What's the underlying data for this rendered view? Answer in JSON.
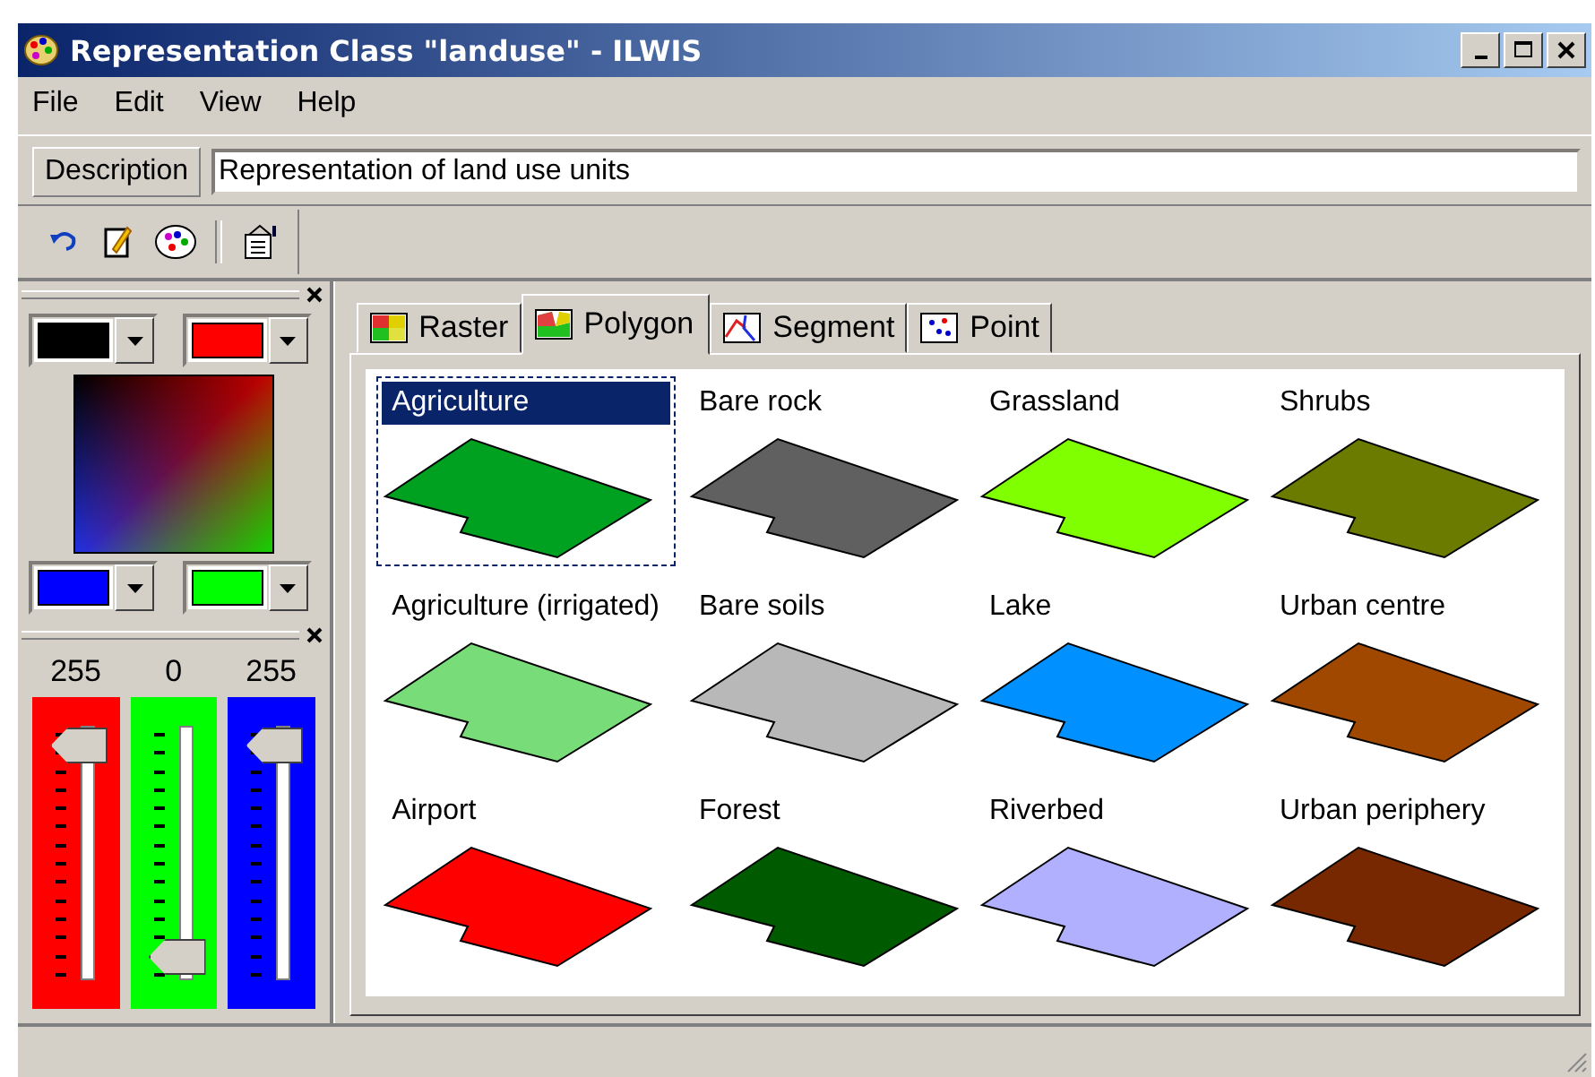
{
  "window": {
    "title": "Representation Class \"landuse\" - ILWIS"
  },
  "menu": [
    "File",
    "Edit",
    "View",
    "Help"
  ],
  "description": {
    "label": "Description",
    "value": "Representation of land use units"
  },
  "swatches": [
    {
      "color": "#000000"
    },
    {
      "color": "#ff0000"
    },
    {
      "color": "#0000ff"
    },
    {
      "color": "#00ff00"
    }
  ],
  "sliders": [
    {
      "reading": "255",
      "level": 1,
      "color": "#ff0000"
    },
    {
      "reading": "0",
      "level": 0,
      "color": "#00ff00"
    },
    {
      "reading": "255",
      "level": 1,
      "color": "#0000ff"
    }
  ],
  "tabs": [
    {
      "label": "Raster",
      "selected": false
    },
    {
      "label": "Polygon",
      "selected": true
    },
    {
      "label": "Segment",
      "selected": false
    },
    {
      "label": "Point",
      "selected": false
    }
  ],
  "classes": [
    {
      "name": "Agriculture",
      "color": "#00a020",
      "selected": true
    },
    {
      "name": "Bare rock",
      "color": "#606060",
      "selected": false
    },
    {
      "name": "Grassland",
      "color": "#80ff00",
      "selected": false
    },
    {
      "name": "Shrubs",
      "color": "#6b7b00",
      "selected": false
    },
    {
      "name": "Agriculture (irrigated)",
      "color": "#78dc78",
      "selected": false
    },
    {
      "name": "Bare soils",
      "color": "#b8b8b8",
      "selected": false
    },
    {
      "name": "Lake",
      "color": "#0090ff",
      "selected": false
    },
    {
      "name": "Urban centre",
      "color": "#a04800",
      "selected": false
    },
    {
      "name": "Airport",
      "color": "#ff0000",
      "selected": false
    },
    {
      "name": "Forest",
      "color": "#005a00",
      "selected": false
    },
    {
      "name": "Riverbed",
      "color": "#b0b0ff",
      "selected": false
    },
    {
      "name": "Urban periphery",
      "color": "#782800",
      "selected": false
    }
  ]
}
